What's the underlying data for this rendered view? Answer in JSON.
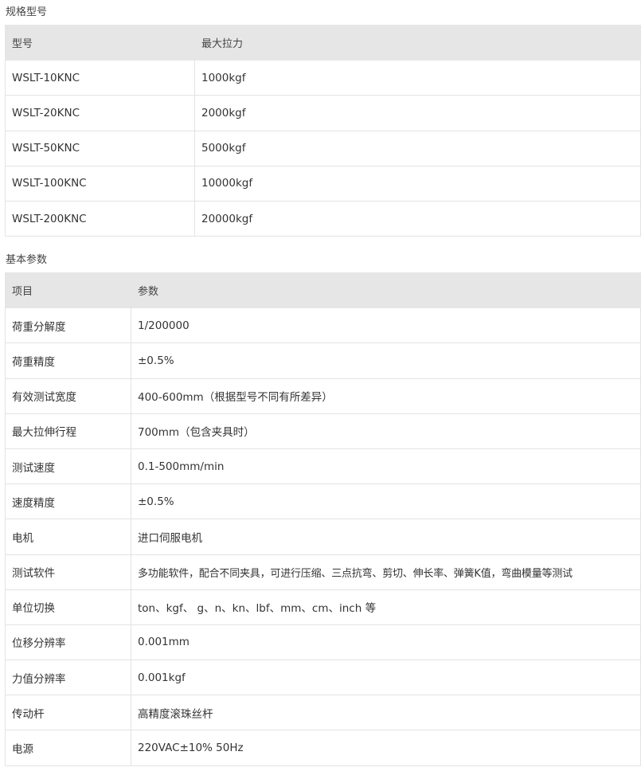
{
  "spec": {
    "title": "规格型号",
    "headers": [
      "型号",
      "最大拉力"
    ],
    "rows": [
      [
        "WSLT-10KNC",
        "1000kgf"
      ],
      [
        "WSLT-20KNC",
        "2000kgf"
      ],
      [
        "WSLT-50KNC",
        "5000kgf"
      ],
      [
        "WSLT-100KNC",
        "10000kgf"
      ],
      [
        "WSLT-200KNC",
        "20000kgf"
      ]
    ]
  },
  "basic": {
    "title": "基本参数",
    "headers": [
      "项目",
      "参数"
    ],
    "rows": [
      [
        "荷重分解度",
        "1/200000"
      ],
      [
        "荷重精度",
        "±0.5%"
      ],
      [
        "有效测试宽度",
        "400-600mm（根据型号不同有所差异）"
      ],
      [
        "最大拉伸行程",
        "700mm（包含夹具时）"
      ],
      [
        "测试速度",
        "0.1-500mm/min"
      ],
      [
        "速度精度",
        "±0.5%"
      ],
      [
        "电机",
        "进口伺服电机"
      ],
      [
        "测试软件",
        "多功能软件，配合不同夹具，可进行压缩、三点抗弯、剪切、伸长率、弹簧K值，弯曲模量等测试"
      ],
      [
        "单位切换",
        "ton、kgf、 g、n、kn、lbf、mm、cm、inch 等"
      ],
      [
        "位移分辨率",
        "0.001mm"
      ],
      [
        "力值分辨率",
        "0.001kgf"
      ],
      [
        "传动杆",
        "高精度滚珠丝杆"
      ],
      [
        "电源",
        "220VAC±10% 50Hz"
      ]
    ]
  }
}
